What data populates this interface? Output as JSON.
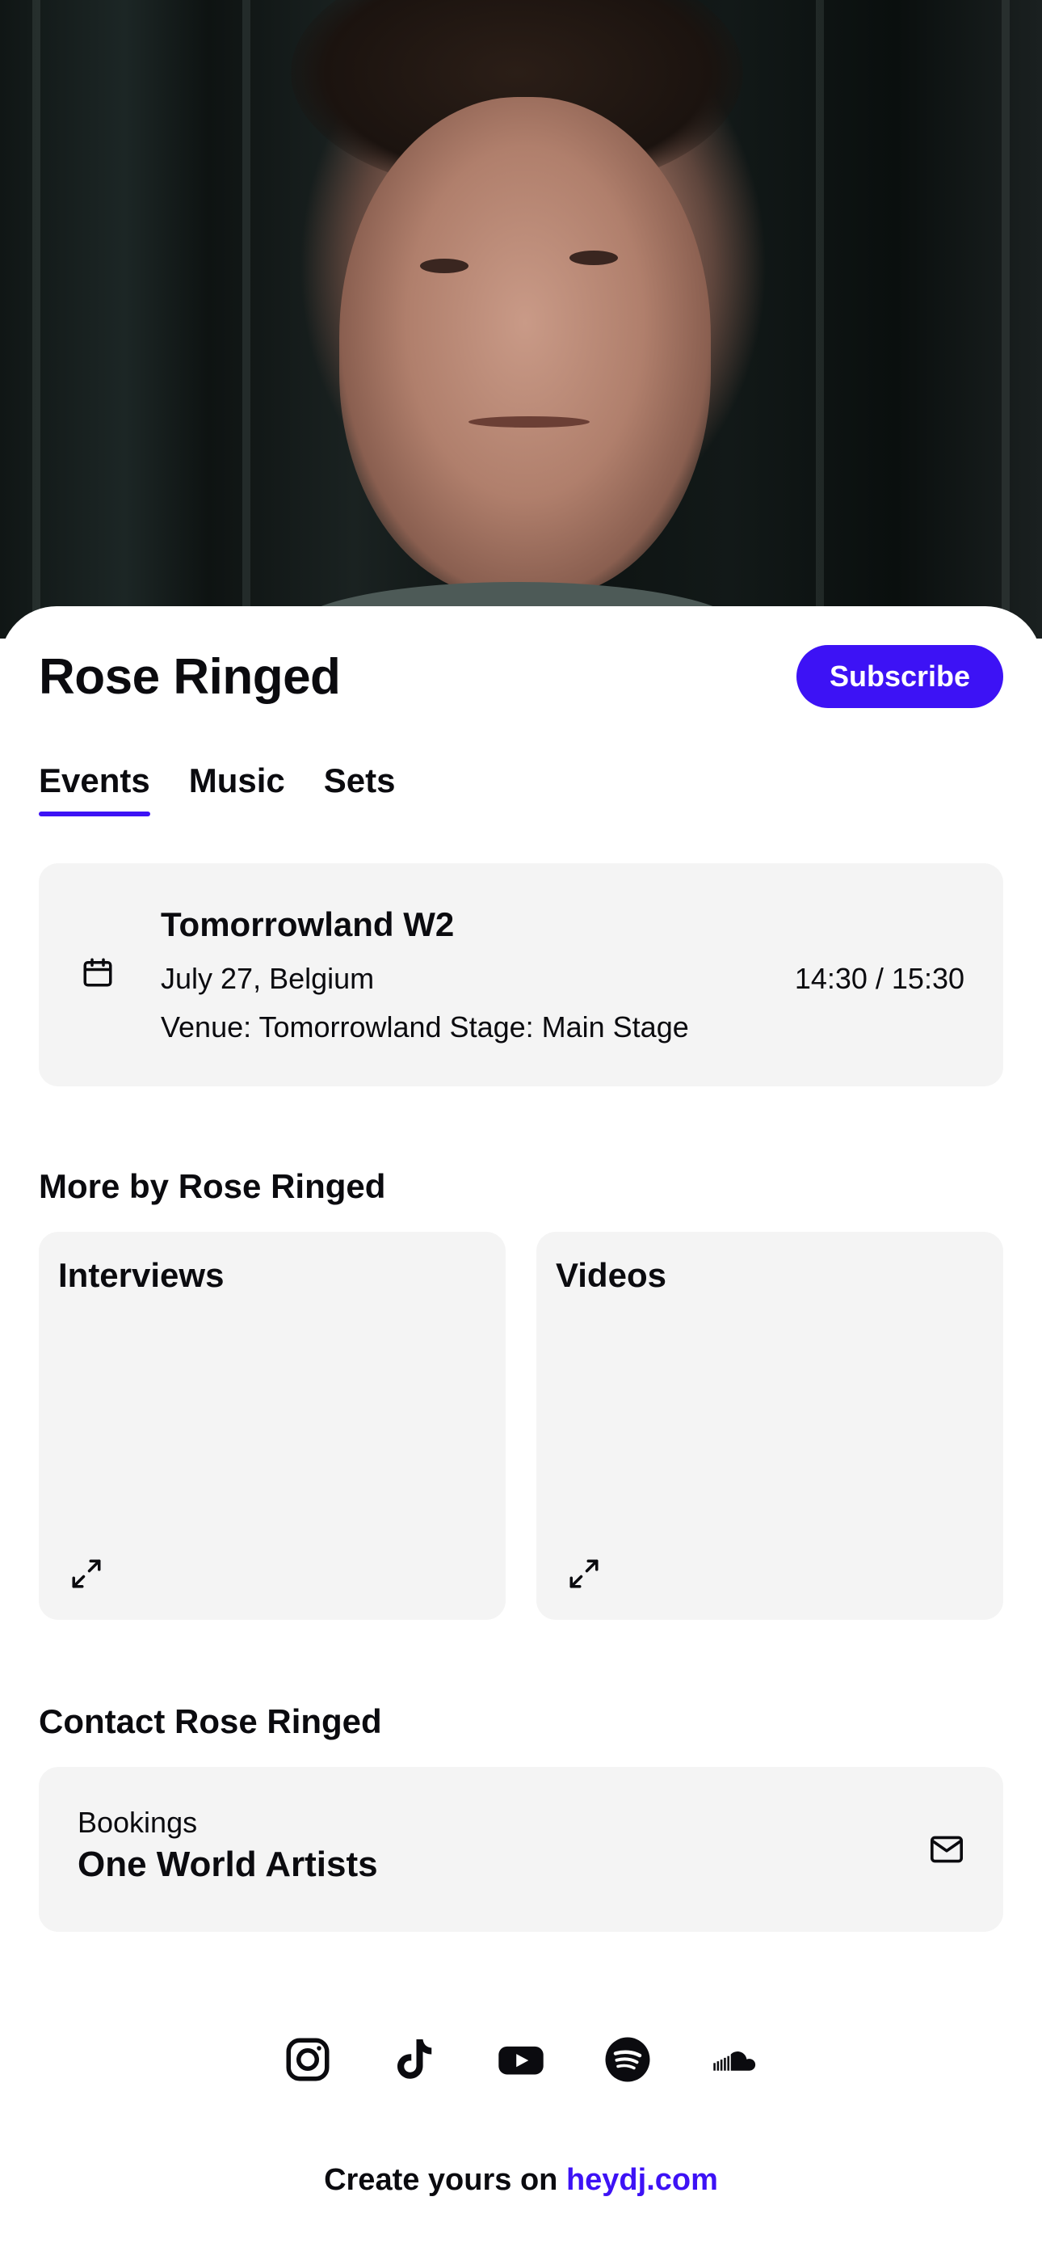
{
  "artist": {
    "name": "Rose Ringed",
    "subscribe_label": "Subscribe"
  },
  "tabs": [
    {
      "label": "Events",
      "active": true
    },
    {
      "label": "Music",
      "active": false
    },
    {
      "label": "Sets",
      "active": false
    }
  ],
  "event": {
    "icon": "calendar-icon",
    "title": "Tomorrowland W2",
    "date_location": "July 27, Belgium",
    "venue": "Venue: Tomorrowland Stage: Main Stage",
    "time": "14:30 / 15:30"
  },
  "more": {
    "title": "More by Rose Ringed",
    "tiles": [
      {
        "label": "Interviews",
        "icon": "expand-icon"
      },
      {
        "label": "Videos",
        "icon": "expand-icon"
      }
    ]
  },
  "contact": {
    "title": "Contact Rose Ringed",
    "kind": "Bookings",
    "agency": "One World Artists",
    "icon": "mail-icon"
  },
  "socials": [
    "instagram-icon",
    "tiktok-icon",
    "youtube-icon",
    "spotify-icon",
    "soundcloud-icon"
  ],
  "footer": {
    "prefix": "Create yours on ",
    "link": "heydj.com"
  },
  "colors": {
    "accent": "#3d12f5",
    "card": "#f4f4f4",
    "text": "#0b0b0f"
  }
}
